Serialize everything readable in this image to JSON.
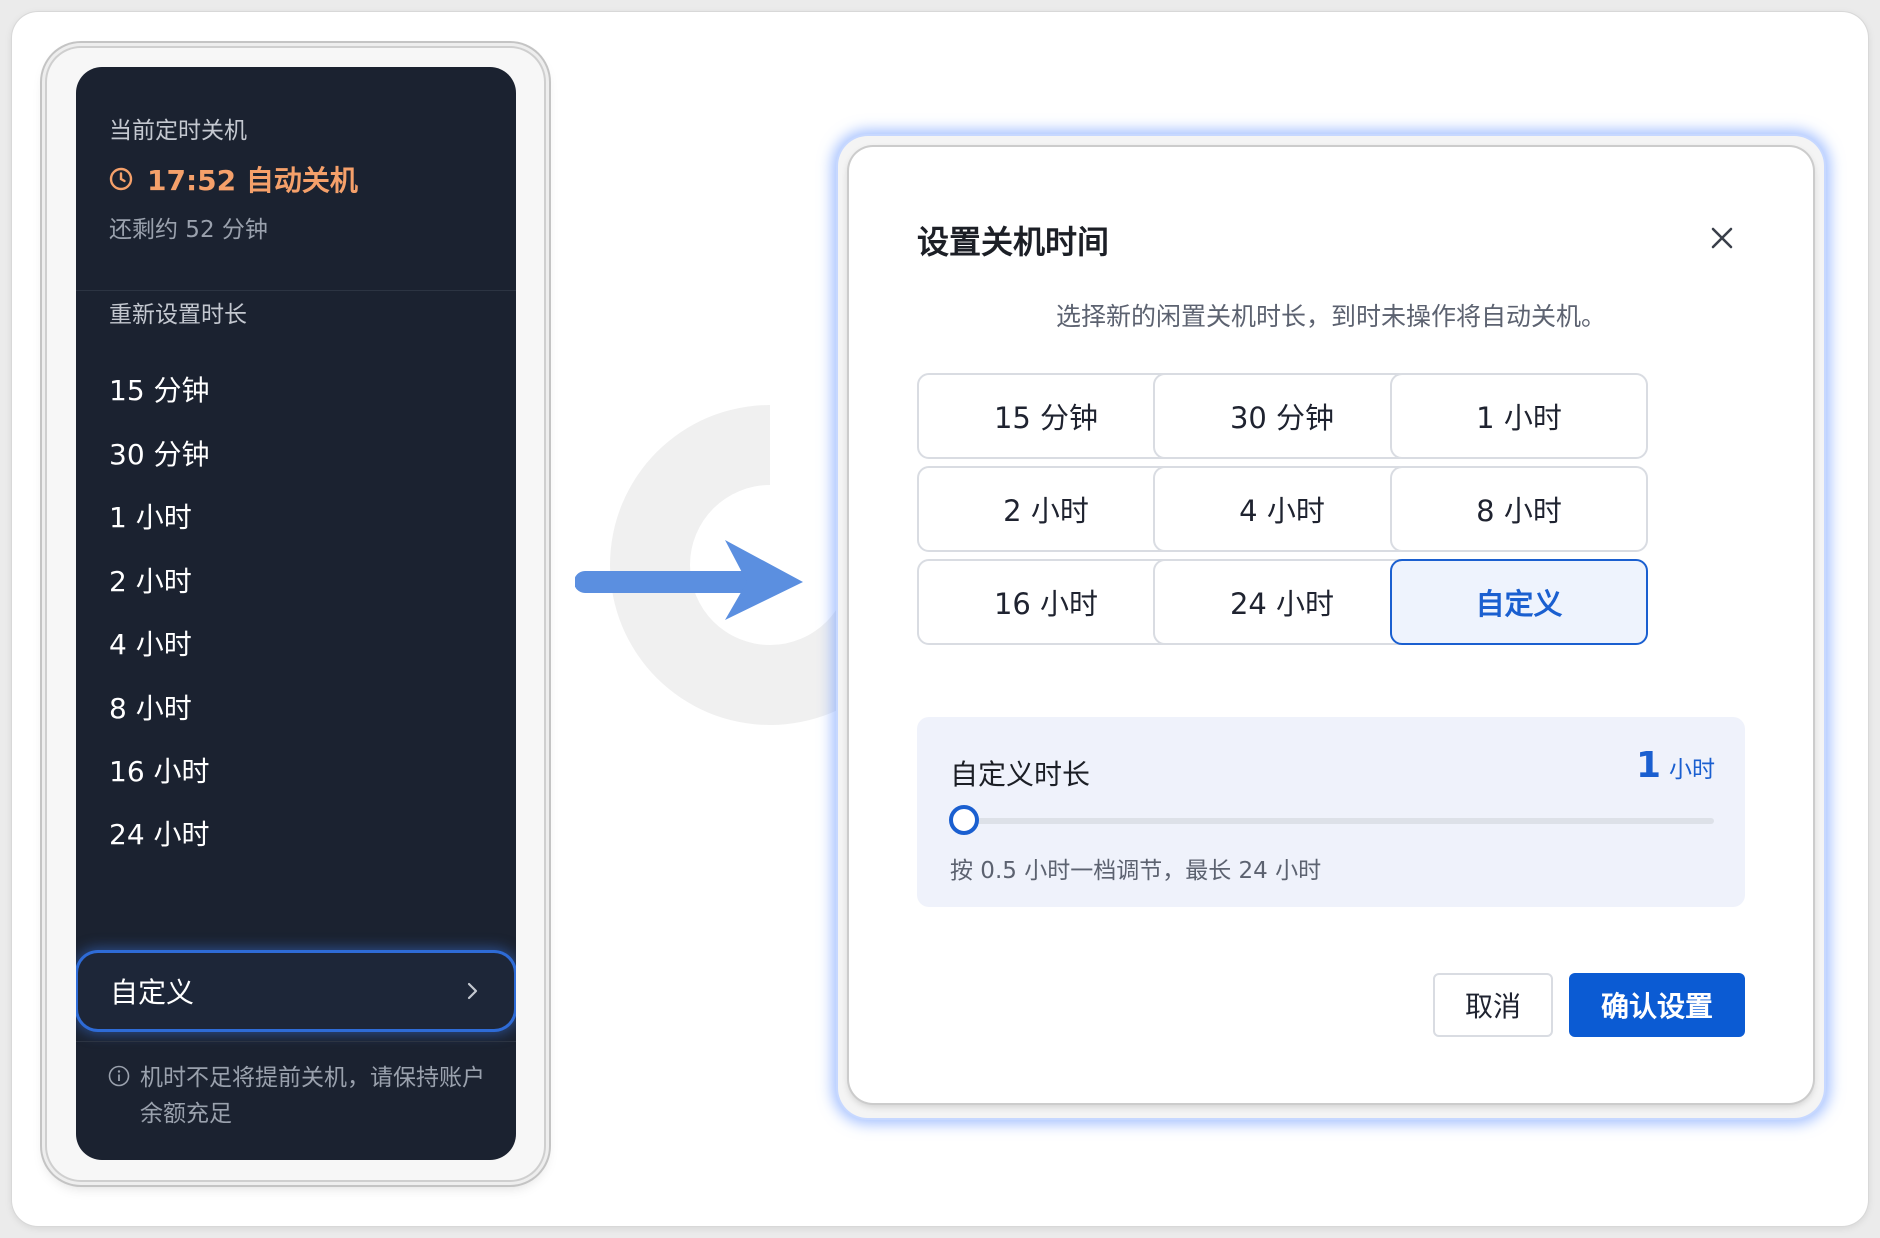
{
  "menu": {
    "current_label": "当前定时关机",
    "current_time": "17:52 自动关机",
    "remaining": "还剩约 52 分钟",
    "reset_label": "重新设置时长",
    "options": [
      "15 分钟",
      "30 分钟",
      "1 小时",
      "2 小时",
      "4 小时",
      "8 小时",
      "16 小时",
      "24 小时"
    ],
    "custom_label": "自定义",
    "note": "机时不足将提前关机，请保持账户余额充足",
    "accent_color": "#f5a06a"
  },
  "dialog": {
    "title": "设置关机时间",
    "subtitle": "选择新的闲置关机时长，到时未操作将自动关机。",
    "options": [
      "15 分钟",
      "30 分钟",
      "1 小时",
      "2 小时",
      "4 小时",
      "8 小时",
      "16 小时",
      "24 小时",
      "自定义"
    ],
    "selected": "自定义",
    "custom": {
      "label": "自定义时长",
      "value": "1",
      "unit": "小时",
      "slider_fraction": 0.0,
      "hint": "按 0.5 小时一档调节，最长 24 小时"
    },
    "cancel_label": "取消",
    "confirm_label": "确认设置",
    "primary_color": "#0b5bd3"
  },
  "icons": {
    "clock": "clock-icon",
    "chevron": "chevron-right-icon",
    "info": "info-icon",
    "close": "close-icon",
    "arrow": "arrow-right-icon"
  }
}
